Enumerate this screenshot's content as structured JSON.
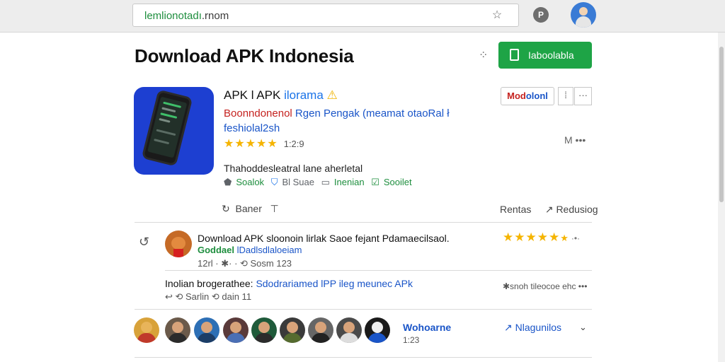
{
  "browser": {
    "url_prefix": "lemlionotadı",
    "url_suffix": ".rnom",
    "toolbar_icon": "P"
  },
  "header": {
    "title": "Download APK Indonesia",
    "install_label": "Iaboolabla"
  },
  "app": {
    "name_main": "APK l APK",
    "name_tag": "ilorama",
    "badge": "⚠",
    "developer_red": "Boonndonenol",
    "developer_blue": " Rgen Pengak  (meamat otaoRal ł",
    "developer_line2": "feshiolal2sh",
    "stars": "★★★★★",
    "rating_text": "1:2:9",
    "description": "Thahoddesleatral lane aherletal",
    "chip1": "Soalok",
    "chip2": "Bl Suae",
    "chip3": "Inenian",
    "chip4": "Sooilet",
    "mod_red": "Mod",
    "mod_blue": "olonl",
    "more_label": "M •••",
    "action_left_label": "Baner",
    "action_right_label": "Rentas",
    "action_right2_label": "Redusiog"
  },
  "review": {
    "title": "Download APK sloonoin lirlak Saoe fejant Pdamaecilsaol.",
    "user_green": "Goddael",
    "user_blue": " lDadlsdlaloeiam",
    "meta": "12rl  ·  ✱·  ·   ⟲  Sosm 123",
    "stars": "★★★★★",
    "stars_empty": "★",
    "stars_num": "·•·",
    "reply_black": "Inolian brogerathee: ",
    "reply_blue": "Sdodrariamed lPP ileg meunec APk",
    "reply_meta": "↩ ⟲ Sarlin ⟲ dain 11",
    "reply_right": "✱snoh tileocoe ehc •••"
  },
  "footer": {
    "users_label": "Wohoarne",
    "users_count": "1:23",
    "link_label": "Nlagunilos",
    "chevron": "⌄"
  },
  "colors": {
    "install_green": "#1ea446",
    "link_blue": "#1a55c8",
    "star_yellow": "#f5b400"
  }
}
